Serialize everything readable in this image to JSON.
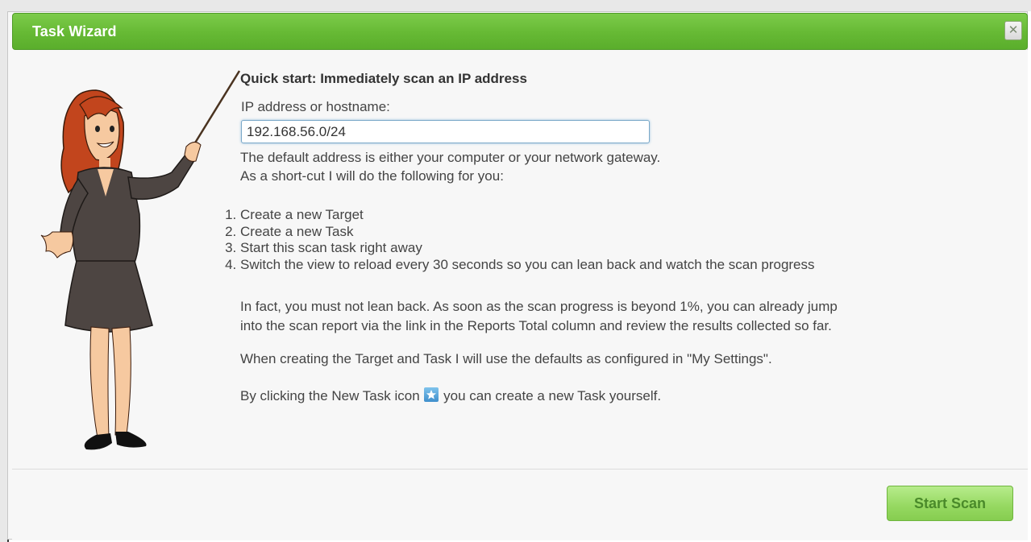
{
  "dialog": {
    "title": "Task Wizard",
    "close_icon": "close-icon",
    "accent_color": "#66b934"
  },
  "wizard": {
    "heading": "Quick start: Immediately scan an IP address",
    "ip_label": "IP address or hostname:",
    "ip_value": "192.168.56.0/24",
    "default_note": "The default address is either your computer or your network gateway.",
    "shortcut_intro": "As a short-cut I will do the following for you:",
    "steps": [
      "Create a new Target",
      "Create a new Task",
      "Start this scan task right away",
      "Switch the view to reload every 30 seconds so you can lean back and watch the scan progress"
    ],
    "fact_line1": "In fact, you must not lean back. As soon as the scan progress is beyond 1%, you can already jump",
    "fact_line2": "into the scan report via the link in the Reports Total column and review the results collected so far.",
    "defaults_note": "When creating the Target and Task I will use the defaults as configured in \"My Settings\".",
    "new_task_before": "By clicking the New Task icon",
    "new_task_after": "you can create a new Task yourself.",
    "new_task_icon": "new-task-star-icon"
  },
  "footer": {
    "start_scan_label": "Start Scan"
  }
}
